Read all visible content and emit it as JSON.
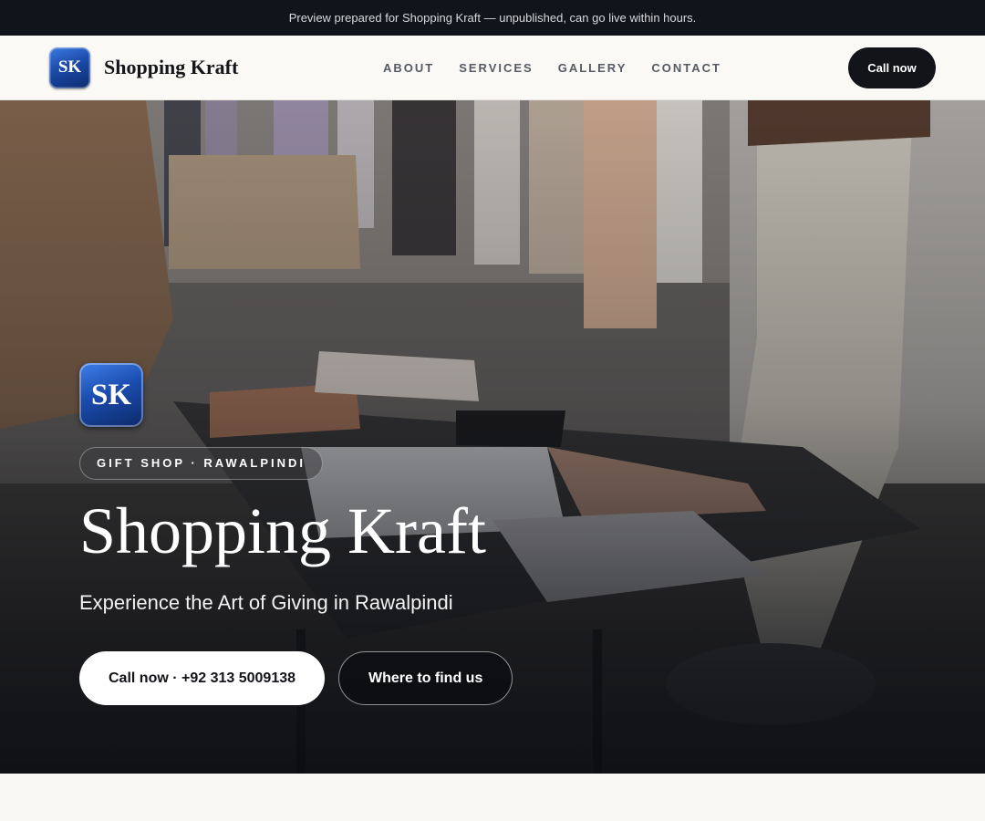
{
  "preview_banner": "Preview prepared for Shopping Kraft — unpublished, can go live within hours.",
  "brand": {
    "logo_text": "SK",
    "name": "Shopping Kraft"
  },
  "nav": {
    "links": [
      "ABOUT",
      "SERVICES",
      "GALLERY",
      "CONTACT"
    ],
    "cta": "Call now"
  },
  "hero": {
    "logo_text": "SK",
    "eyebrow": "GIFT SHOP · RAWALPINDI",
    "title": "Shopping Kraft",
    "subtitle": "Experience the Art of Giving in Rawalpindi",
    "primary_button": "Call now · +92 313 5009138",
    "secondary_button": "Where to find us"
  },
  "colors": {
    "dark": "#11141a",
    "logo_blue": "#1b4aa8",
    "page_bg": "#f9f8f5"
  }
}
